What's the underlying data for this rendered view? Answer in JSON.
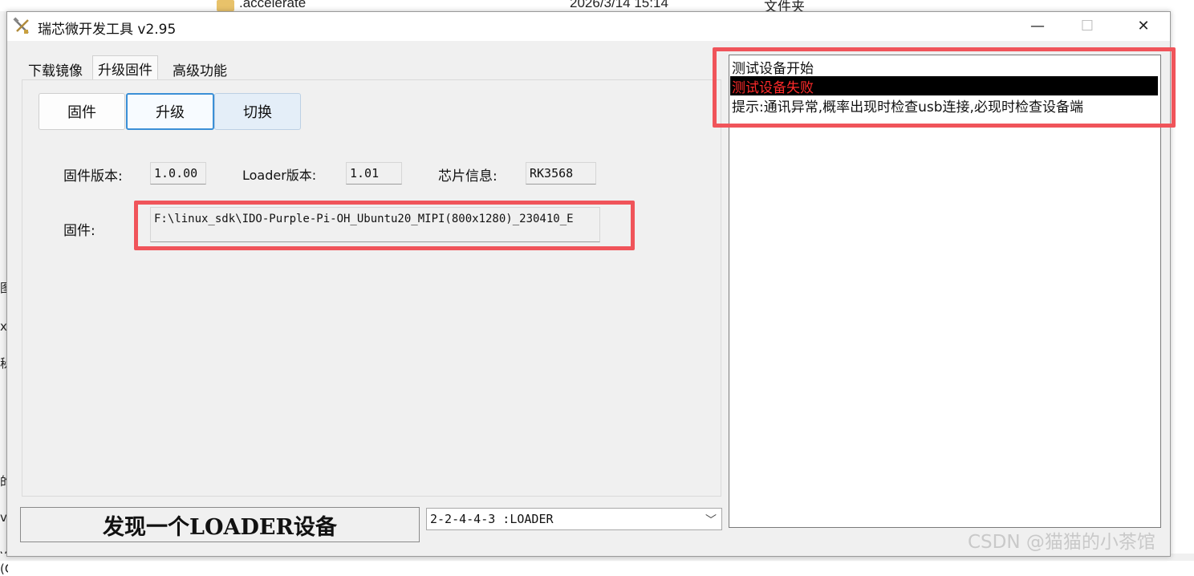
{
  "background": {
    "file_name": ".accelerate",
    "file_date": "2026/3/14 15:14",
    "file_type": "文件夹",
    "left_edge_fragments": [
      "图",
      "x_",
      "秘",
      "的",
      "vs",
      "ySr)v (C:)"
    ]
  },
  "window": {
    "title": "瑞芯微开发工具 v2.95",
    "controls": {
      "minimize": "—",
      "maximize": "☐",
      "close": "✕"
    }
  },
  "tabs": [
    {
      "label": "下载镜像",
      "active": false
    },
    {
      "label": "升级固件",
      "active": true
    },
    {
      "label": "高级功能",
      "active": false
    }
  ],
  "buttons": {
    "firmware": "固件",
    "upgrade": "升级",
    "switch": "切换"
  },
  "info": {
    "firmware_version_label": "固件版本:",
    "firmware_version": "1.0.00",
    "loader_version_label": "Loader版本:",
    "loader_version": "1.01",
    "chip_info_label": "芯片信息:",
    "chip_info": "RK3568",
    "firmware_path_label": "固件:",
    "firmware_path": "F:\\linux_sdk\\IDO-Purple-Pi-OH_Ubuntu20_MIPI(800x1280)_230410_E"
  },
  "status": {
    "message": "发现一个LOADER设备",
    "device_selected": "2-2-4-4-3 :LOADER"
  },
  "log": {
    "lines": [
      "测试设备开始",
      "测试设备失败",
      "提示:通讯异常,概率出现时检查usb连接,必现时检查设备端"
    ]
  },
  "watermark": "CSDN @猫猫的小茶馆",
  "colors": {
    "highlight_box": "#f0545a",
    "selected_line_bg": "#000000",
    "selected_line_text": "#ff2a2a",
    "primary_button_border": "#3b8fd6"
  }
}
